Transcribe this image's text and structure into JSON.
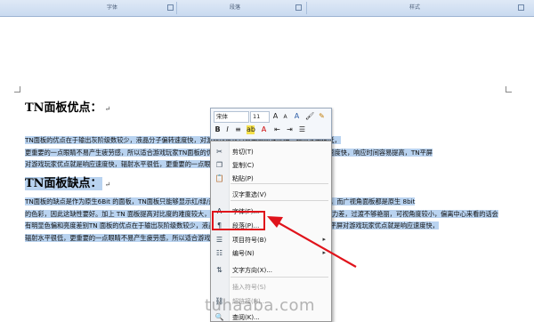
{
  "ribbon": {
    "groups": [
      "字体",
      "段落",
      "样式"
    ]
  },
  "document": {
    "heading1": "TN面板优点：",
    "para1_lines": [
      "TN面板的优点在于输出灰阶级数较少，液晶分子偏转速度快，对游戏玩家优点就是响应速度快，辐射水平很低，",
      "更重要的一点眼睛不易产生疲劳感，所以适合游戏玩家TN面板的优点在于输出灰阶级数较少，液晶分子偏转速度快，响应时间容易提高，TN平屏",
      "对游戏玩家优点就是响应速度快，辐射水平很低，更重要的一点眼睛不易产生疲劳感，所以适合游戏玩家。"
    ],
    "heading2": "TN面板缺点：",
    "para2_lines": [
      "TN面板的缺点是作为原生6Bit 的面板，TN面板只能够显示红/绿/蓝各64色，最大实际色彩仅有 262,144 种，而广视角面板都是原生 8bit",
      "的色彩，因此这缺性要好。加上 TN 面板提高对比度的难度较大，直接暴露出来的问题就是色彩单薄，还原能力差，过渡不够艳丽，可视角度较小，偏离中心来看的话会",
      "有明显色偏和亮度差别TN 面板的优点在于输出灰阶级数较少，液晶分子偏转速度快，响应时间容易提高,TN 平屏对游戏玩家优点就是响应速度快，",
      "辐射水平很低，更重要的一点眼睛不易产生疲劳感，所以适合游戏玩家。"
    ]
  },
  "mini_toolbar": {
    "font_name": "宋体",
    "font_size": "11",
    "grow_font": "A",
    "shrink_font": "A",
    "bold": "B",
    "italic": "I",
    "underline": "≡"
  },
  "context_menu": {
    "items": [
      {
        "label": "剪切(T)",
        "icon": "scissors-icon",
        "glyph": "✂",
        "disabled": false,
        "submenu": false
      },
      {
        "label": "复制(C)",
        "icon": "copy-icon",
        "glyph": "❐",
        "disabled": false,
        "submenu": false
      },
      {
        "label": "粘贴(P)",
        "icon": "paste-icon",
        "glyph": "📋",
        "disabled": false,
        "submenu": false
      },
      {
        "label": "汉字重选(V)",
        "icon": "",
        "glyph": "",
        "disabled": false,
        "submenu": false
      },
      {
        "label": "字体(F)...",
        "icon": "font-icon",
        "glyph": "A",
        "disabled": false,
        "submenu": false
      },
      {
        "label": "段落(P)...",
        "icon": "paragraph-icon",
        "glyph": "¶",
        "disabled": false,
        "submenu": false
      },
      {
        "label": "项目符号(B)",
        "icon": "bullets-icon",
        "glyph": "☰",
        "disabled": false,
        "submenu": true
      },
      {
        "label": "编号(N)",
        "icon": "numbering-icon",
        "glyph": "☷",
        "disabled": false,
        "submenu": true
      },
      {
        "label": "文字方向(X)...",
        "icon": "text-direction-icon",
        "glyph": "⇅",
        "disabled": false,
        "submenu": false
      },
      {
        "label": "插入符号(S)",
        "icon": "",
        "glyph": "",
        "disabled": true,
        "submenu": false
      },
      {
        "label": "超链接(H)...",
        "icon": "hyperlink-icon",
        "glyph": "⛓",
        "disabled": true,
        "submenu": false
      },
      {
        "label": "查阅(K)...",
        "icon": "lookup-icon",
        "glyph": "🔍",
        "disabled": false,
        "submenu": false
      }
    ]
  },
  "colors": {
    "selection": "#b9d3f0",
    "highlight_box": "#e0131b",
    "arrow": "#e0131b"
  },
  "watermark": "tuhaaba.com"
}
